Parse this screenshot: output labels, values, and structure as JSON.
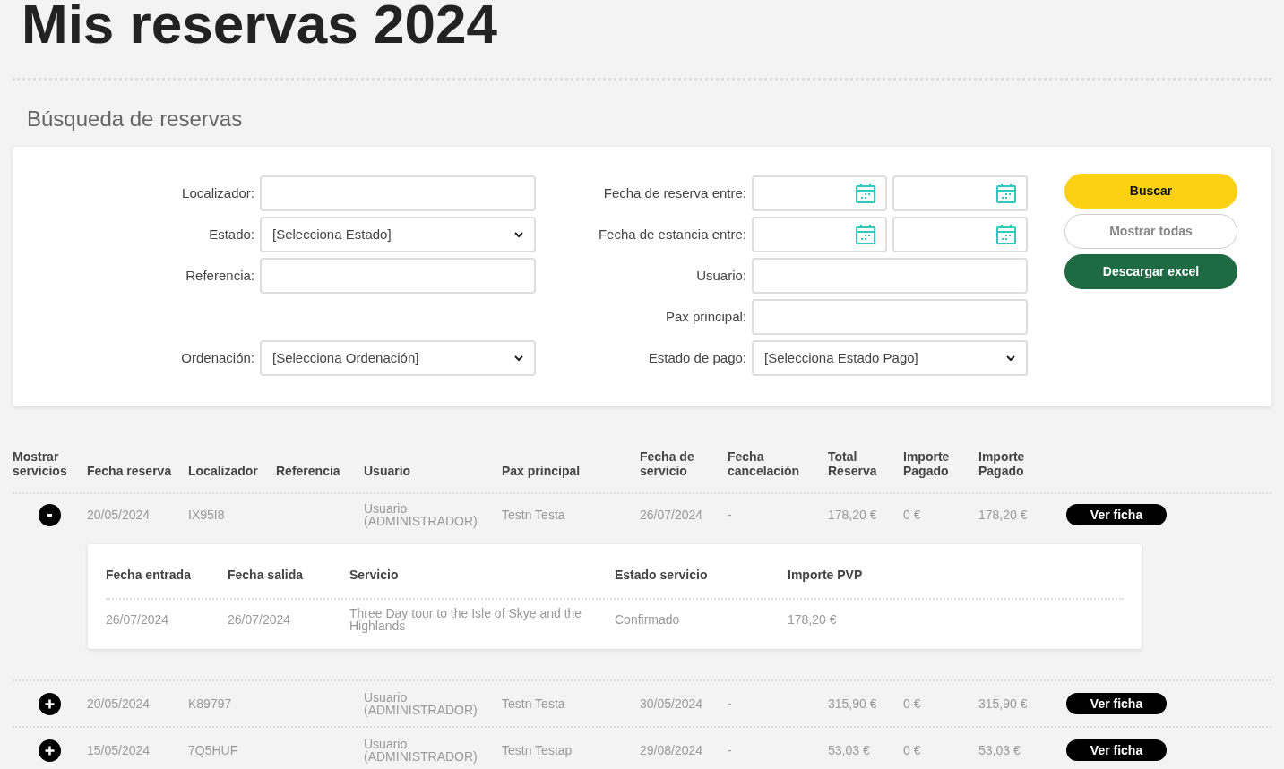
{
  "title": "Mis reservas 2024",
  "search_title": "Búsqueda de reservas",
  "form": {
    "rows": [
      {
        "left": {
          "label": "Localizador:",
          "kind": "text"
        },
        "right": {
          "label": "Fecha de reserva entre:",
          "kind": "daterange"
        }
      },
      {
        "left": {
          "label": "Estado:",
          "kind": "select",
          "value": "[Selecciona Estado]"
        },
        "right": {
          "label": "Fecha de estancia entre:",
          "kind": "daterange"
        }
      },
      {
        "left": {
          "label": "Referencia:",
          "kind": "text"
        },
        "right": {
          "label": "Usuario:",
          "kind": "text"
        }
      },
      {
        "right": {
          "label": "Pax principal:",
          "kind": "text"
        }
      },
      {
        "left": {
          "label": "Ordenación:",
          "kind": "select",
          "value": "[Selecciona Ordenación]"
        },
        "right": {
          "label": "Estado de pago:",
          "kind": "select",
          "value": "[Selecciona Estado Pago]"
        }
      }
    ],
    "buttons": [
      {
        "label": "Buscar",
        "kind": "primary"
      },
      {
        "label": "Mostrar todas",
        "kind": "outline"
      },
      {
        "label": "Descargar excel",
        "kind": "success"
      }
    ]
  },
  "table": {
    "columns": [
      "Mostrar servicios",
      "Fecha reserva",
      "Localizador",
      "Referencia",
      "Usuario",
      "Pax principal",
      "Fecha de servicio",
      "Fecha cancelación",
      "Total Reserva",
      "Importe Pagado",
      "Importe Pagado"
    ],
    "rows": [
      {
        "expanded": true,
        "cells": [
          "",
          "20/05/2024",
          "IX95I8",
          "",
          "Usuario (ADMINISTRADOR)",
          "Testn Testa",
          "26/07/2024",
          "-",
          "178,20 €",
          "0 €",
          "178,20 €"
        ],
        "action": "Ver ficha",
        "services": {
          "columns": [
            "Fecha entrada",
            "Fecha salida",
            "Servicio",
            "Estado servicio",
            "Importe PVP"
          ],
          "rows": [
            [
              "26/07/2024",
              "26/07/2024",
              "Three Day tour to the Isle of Skye and the Highlands",
              "Confirmado",
              "178,20 €"
            ]
          ]
        }
      },
      {
        "expanded": false,
        "cells": [
          "",
          "20/05/2024",
          "K89797",
          "",
          "Usuario (ADMINISTRADOR)",
          "Testn Testa",
          "30/05/2024",
          "-",
          "315,90 €",
          "0 €",
          "315,90 €"
        ],
        "action": "Ver ficha"
      },
      {
        "expanded": false,
        "cells": [
          "",
          "15/05/2024",
          "7Q5HUF",
          "",
          "Usuario (ADMINISTRADOR)",
          "Testn Testap",
          "29/08/2024",
          "-",
          "53,03 €",
          "0 €",
          "53,03 €"
        ],
        "action": "Ver ficha"
      }
    ]
  }
}
